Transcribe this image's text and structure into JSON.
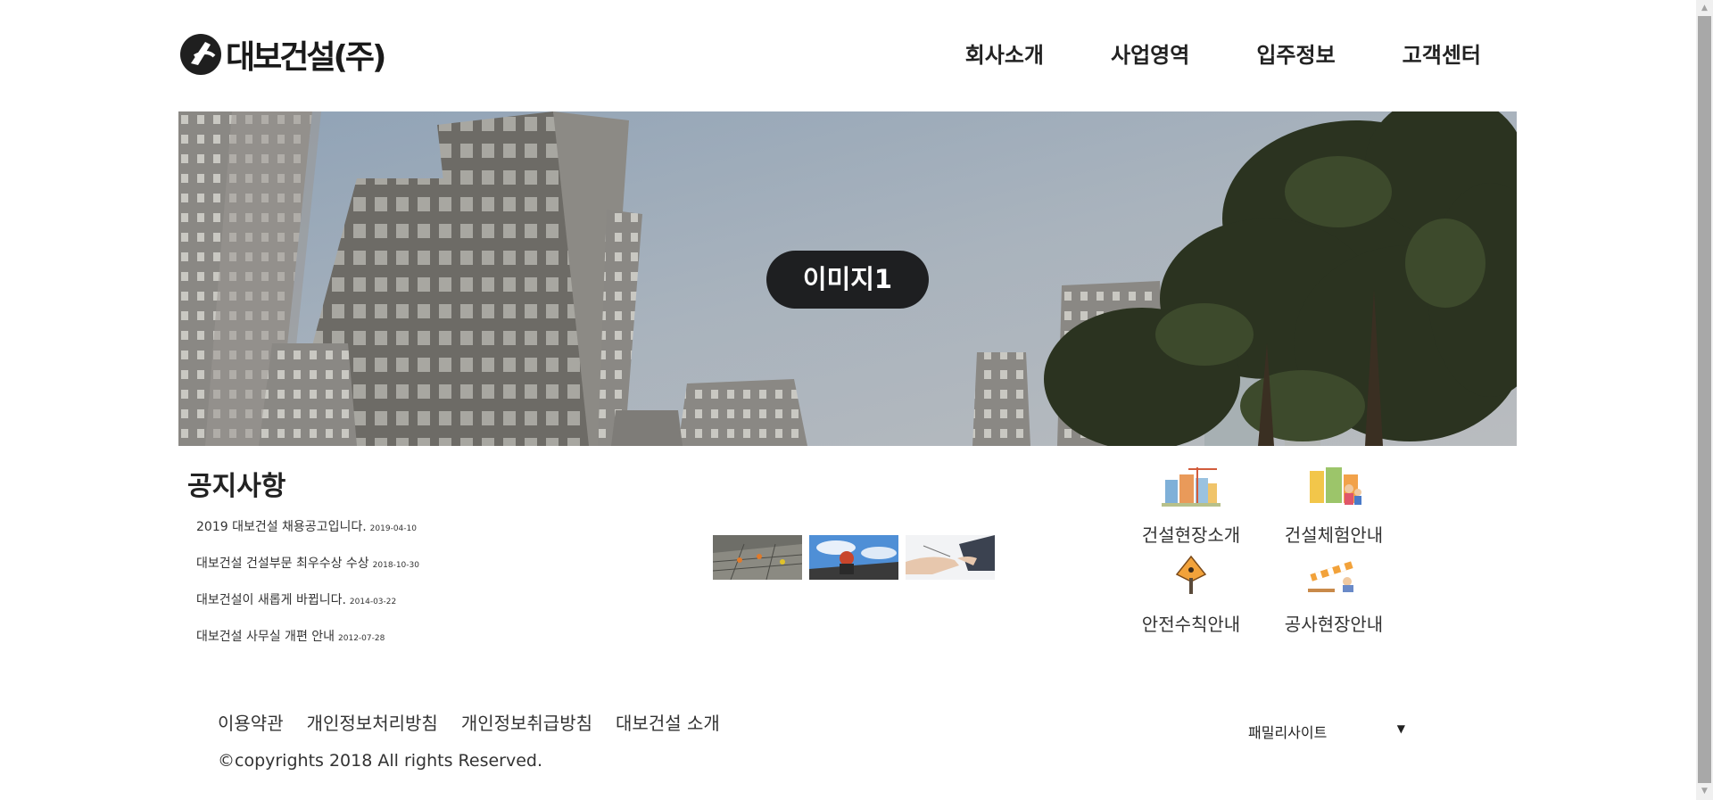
{
  "header": {
    "logo_text": "대보건설(주)",
    "nav": [
      "회사소개",
      "사업영역",
      "입주정보",
      "고객센터"
    ]
  },
  "hero": {
    "label": "이미지1"
  },
  "notice": {
    "title": "공지사항",
    "items": [
      {
        "text": "2019 대보건설 채용공고입니다.",
        "date": "2019-04-10"
      },
      {
        "text": "대보건설 건설부문 최우수상 수상",
        "date": "2018-10-30"
      },
      {
        "text": "대보건설이 새롭게 바뀝니다.",
        "date": "2014-03-22"
      },
      {
        "text": "대보건설 사무실 개편 안내",
        "date": "2012-07-28"
      }
    ]
  },
  "quick_menu": [
    {
      "label": "건설현장소개",
      "icon": "construction-site-icon"
    },
    {
      "label": "건설체험안내",
      "icon": "family-experience-icon"
    },
    {
      "label": "안전수칙안내",
      "icon": "safety-sign-icon"
    },
    {
      "label": "공사현장안내",
      "icon": "road-work-icon"
    }
  ],
  "footer": {
    "links": [
      "이용약관",
      "개인정보처리방침",
      "개인정보취급방침",
      "대보건설 소개"
    ],
    "copyright": "©copyrights 2018 All rights Reserved.",
    "family_site": "패밀리사이트",
    "family_arrow": "▼"
  },
  "scrollbar": {
    "up": "▲",
    "down": "▼"
  }
}
